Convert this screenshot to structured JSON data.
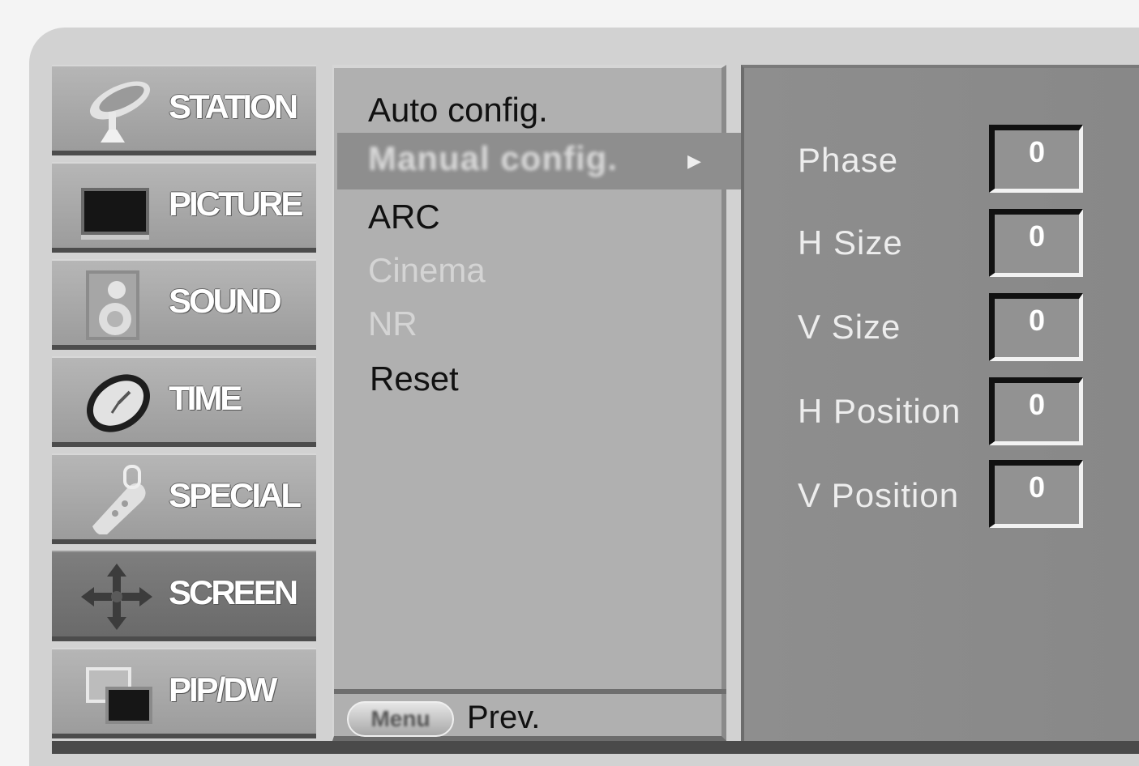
{
  "main_menu": [
    {
      "label": "STATION",
      "icon": "satellite-dish-icon"
    },
    {
      "label": "PICTURE",
      "icon": "tv-screen-icon"
    },
    {
      "label": "SOUND",
      "icon": "speaker-icon"
    },
    {
      "label": "TIME",
      "icon": "clock-icon"
    },
    {
      "label": "SPECIAL",
      "icon": "remote-control-icon"
    },
    {
      "label": "SCREEN",
      "icon": "four-way-arrows-icon"
    },
    {
      "label": "PIP/DW",
      "icon": "pip-windows-icon"
    }
  ],
  "selected_main": "SCREEN",
  "sub_menu": {
    "items": [
      {
        "label": "Auto config.",
        "enabled": true
      },
      {
        "label": "Manual config.",
        "enabled": true,
        "selected": true
      },
      {
        "label": "ARC",
        "enabled": true
      },
      {
        "label": "Cinema",
        "enabled": false
      },
      {
        "label": "NR",
        "enabled": false
      },
      {
        "label": "Reset",
        "enabled": true
      }
    ],
    "selected_arrow": "▶"
  },
  "footer": {
    "menu_button": "Menu",
    "prev_label": "Prev."
  },
  "settings": [
    {
      "label": "Phase",
      "value": "0"
    },
    {
      "label": "H Size",
      "value": "0"
    },
    {
      "label": "V Size",
      "value": "0"
    },
    {
      "label": "H Position",
      "value": "0"
    },
    {
      "label": "V Position",
      "value": "0"
    }
  ],
  "colors": {
    "panel": "#d2d2d2",
    "selected_item": "#8e8e8e",
    "right_panel": "#8e8e8e"
  }
}
